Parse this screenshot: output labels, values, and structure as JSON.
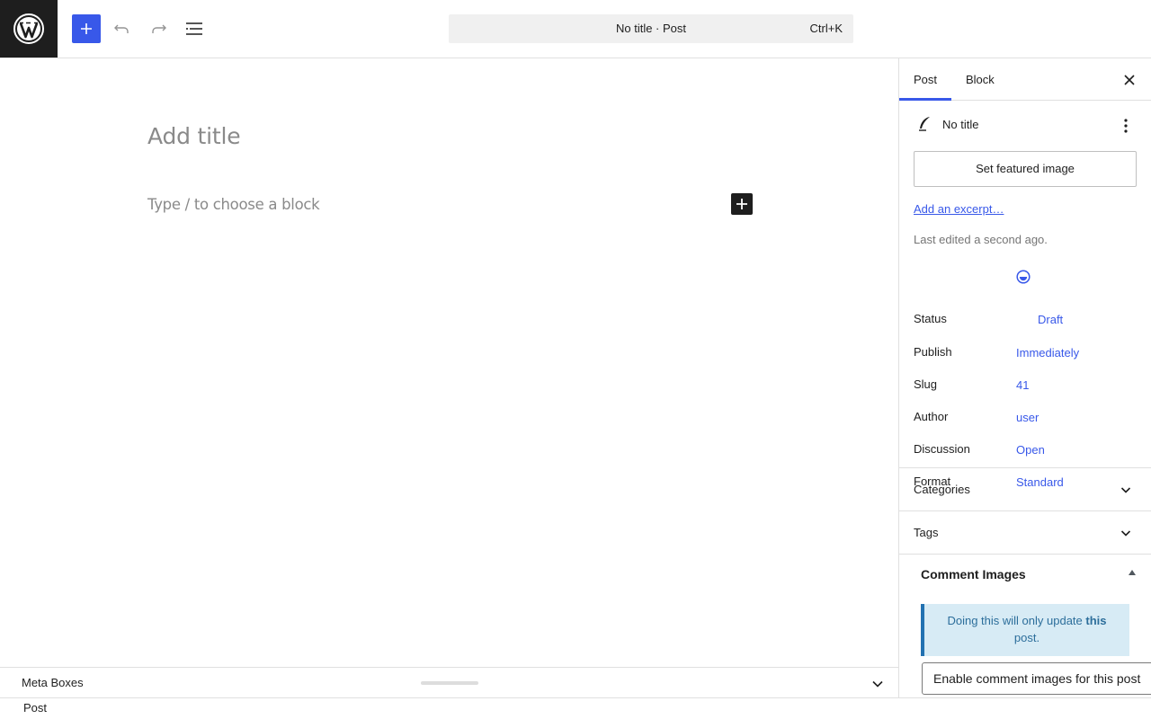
{
  "toolbar": {
    "add_block_label": "Add block",
    "undo_label": "Undo",
    "redo_label": "Redo",
    "document_overview_label": "Document Overview"
  },
  "command_bar": {
    "title": "No title · Post",
    "shortcut": "Ctrl+K"
  },
  "editor": {
    "title_placeholder": "Add title",
    "block_placeholder": "Type / to choose a block"
  },
  "meta_boxes": {
    "title": "Meta Boxes"
  },
  "footer": {
    "breadcrumb": "Post"
  },
  "sidebar": {
    "tabs": [
      "Post",
      "Block"
    ],
    "active_tab": "Post",
    "post_title": "No title",
    "featured_image_button": "Set featured image",
    "excerpt_link": "Add an excerpt…",
    "last_edited": "Last edited a second ago.",
    "rows": [
      {
        "label": "Status",
        "value": "Draft"
      },
      {
        "label": "Publish",
        "value": "Immediately"
      },
      {
        "label": "Slug",
        "value": "41"
      },
      {
        "label": "Author",
        "value": "user"
      },
      {
        "label": "Discussion",
        "value": "Open"
      },
      {
        "label": "Format",
        "value": "Standard"
      }
    ],
    "panels": [
      "Categories",
      "Tags"
    ],
    "comment_images": {
      "title": "Comment Images",
      "notice_text": "Doing this will only update ",
      "notice_strong": "this",
      "notice_end": " post.",
      "select_value": "Enable comment images for this post"
    }
  },
  "colors": {
    "accent": "#3858e9",
    "dark": "#1e1e1e",
    "notice_bg": "#d7ebf5",
    "notice_border": "#2271b1"
  }
}
